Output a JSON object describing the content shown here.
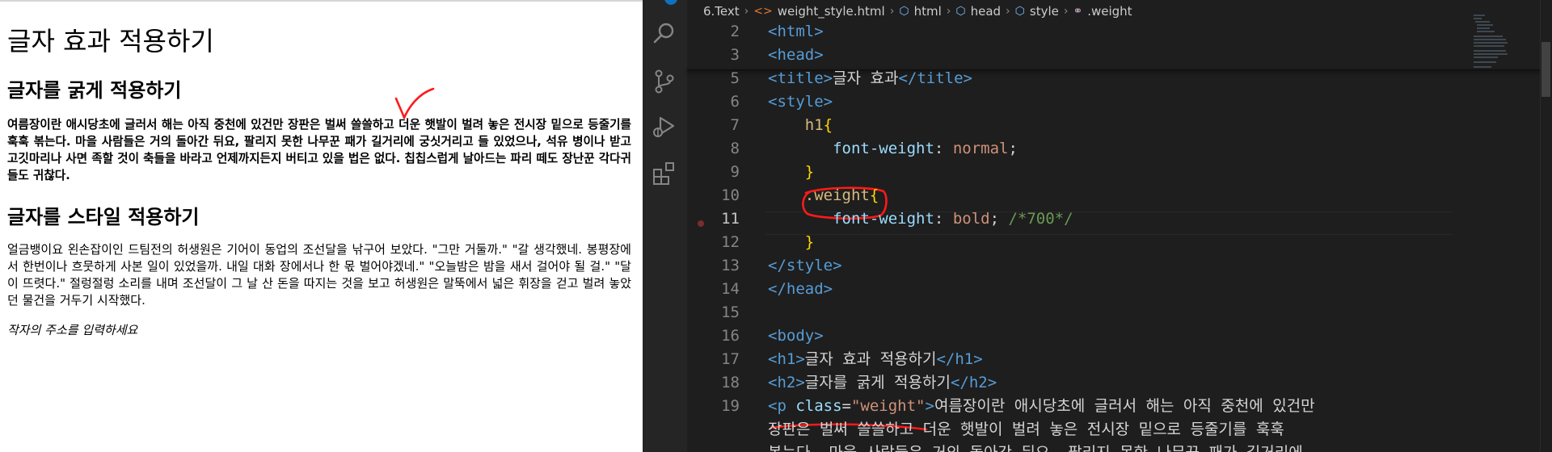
{
  "preview": {
    "h1": "글자 효과 적용하기",
    "h2_bold": "글자를 굵게 적용하기",
    "p_bold": "여름장이란 애시당초에 글러서 해는 아직 중천에 있건만 장판은 벌써 쓸쓸하고 더운 햇발이 벌려 놓은 전시장 밑으로 등줄기를 훅훅 볶는다. 마을 사람들은 거의 돌아간 뒤요, 팔리지 못한 나무꾼 패가 길거리에 궁싯거리고 들 있었으나, 석유 병이나 받고 고깃마리나 사면 족할 것이 축들을 바라고 언제까지든지 버티고 있을 법은 없다. 칩칩스럽게 날아드는 파리 떼도 장난꾼 각다귀들도 귀찮다.",
    "h2_style": "글자를 스타일 적용하기",
    "p_style": "얼금뱅이요 왼손잡이인 드팀전의 허생원은 기어이 동업의 조선달을 낚구어 보았다. \"그만 거둘까.\" \"갈 생각했네. 봉평장에서 한번이나 흐뭇하게 사본 일이 있었을까. 내일 대화 장에서나 한 몫 벌어야겠네.\" \"오늘밤은 밤을 새서 걸어야 될 걸.\" \"달이 뜨렷다.\" 절렁절렁 소리를 내며 조선달이 그 날 산 돈을 따지는 것을 보고 허생원은 말뚝에서 넓은 휘장을 걷고 벌려 놓았던 물건을 거두기 시작했다.",
    "address": "작자의 주소를 입력하세요"
  },
  "editor": {
    "breadcrumb": {
      "folder": "6.Text",
      "file": "weight_style.html",
      "el1": "html",
      "el2": "head",
      "el3": "style",
      "el4": ".weight"
    },
    "lines": [
      {
        "num": "2",
        "parts": [
          [
            "tag",
            "<html>"
          ]
        ]
      },
      {
        "num": "3",
        "parts": [
          [
            "tag",
            "<head>"
          ]
        ]
      },
      {
        "num": "5",
        "parts": [
          [
            "tag",
            "<title>"
          ],
          [
            "txt",
            "글자 효과"
          ],
          [
            "tag",
            "</title>"
          ]
        ]
      },
      {
        "num": "6",
        "parts": [
          [
            "tag",
            "<style>"
          ]
        ]
      },
      {
        "num": "7",
        "parts": [
          [
            "txt",
            "    "
          ],
          [
            "sel",
            "h1"
          ],
          [
            "brace",
            "{"
          ]
        ]
      },
      {
        "num": "8",
        "parts": [
          [
            "txt",
            "       "
          ],
          [
            "prop",
            "font-weight"
          ],
          [
            "txt",
            ": "
          ],
          [
            "val",
            "normal"
          ],
          [
            "txt",
            ";"
          ]
        ]
      },
      {
        "num": "9",
        "parts": [
          [
            "txt",
            "    "
          ],
          [
            "brace",
            "}"
          ]
        ]
      },
      {
        "num": "10",
        "parts": [
          [
            "txt",
            "    "
          ],
          [
            "sel",
            ".weight"
          ],
          [
            "brace",
            "{"
          ]
        ]
      },
      {
        "num": "11",
        "parts": [
          [
            "txt",
            "       "
          ],
          [
            "prop",
            "font-weight"
          ],
          [
            "txt",
            ": "
          ],
          [
            "val",
            "bold"
          ],
          [
            "txt",
            "; "
          ],
          [
            "cmt",
            "/*700*/"
          ]
        ]
      },
      {
        "num": "12",
        "parts": [
          [
            "txt",
            "    "
          ],
          [
            "brace",
            "}"
          ]
        ]
      },
      {
        "num": "13",
        "parts": [
          [
            "tag",
            "</style>"
          ]
        ]
      },
      {
        "num": "14",
        "parts": [
          [
            "tag",
            "</head>"
          ]
        ]
      },
      {
        "num": "15",
        "parts": []
      },
      {
        "num": "16",
        "parts": [
          [
            "tag",
            "<body>"
          ]
        ]
      },
      {
        "num": "17",
        "parts": [
          [
            "tag",
            "<h1>"
          ],
          [
            "txt",
            "글자 효과 적용하기"
          ],
          [
            "tag",
            "</h1>"
          ]
        ]
      },
      {
        "num": "18",
        "parts": [
          [
            "tag",
            "<h2>"
          ],
          [
            "txt",
            "글자를 굵게 적용하기"
          ],
          [
            "tag",
            "</h2>"
          ]
        ]
      },
      {
        "num": "19",
        "parts": [
          [
            "tag",
            "<p "
          ],
          [
            "attr",
            "class"
          ],
          [
            "txt",
            "="
          ],
          [
            "str",
            "\"weight\""
          ],
          [
            "tag",
            ">"
          ],
          [
            "txt",
            "여름장이란 애시당초에 글러서 해는 아직 중천에 있건만"
          ]
        ]
      },
      {
        "num": "",
        "parts": [
          [
            "txt",
            "장판은 벌써 쓸쓸하고 더운 햇발이 벌려 놓은 전시장 밑으로 등줄기를 훅훅"
          ]
        ]
      },
      {
        "num": "",
        "parts": [
          [
            "txt",
            "볶는다. 마을 사람들은 거의 돌아간 뒤요, 팔리지 못한 나무꾼 패가 길거리에"
          ]
        ]
      }
    ]
  }
}
